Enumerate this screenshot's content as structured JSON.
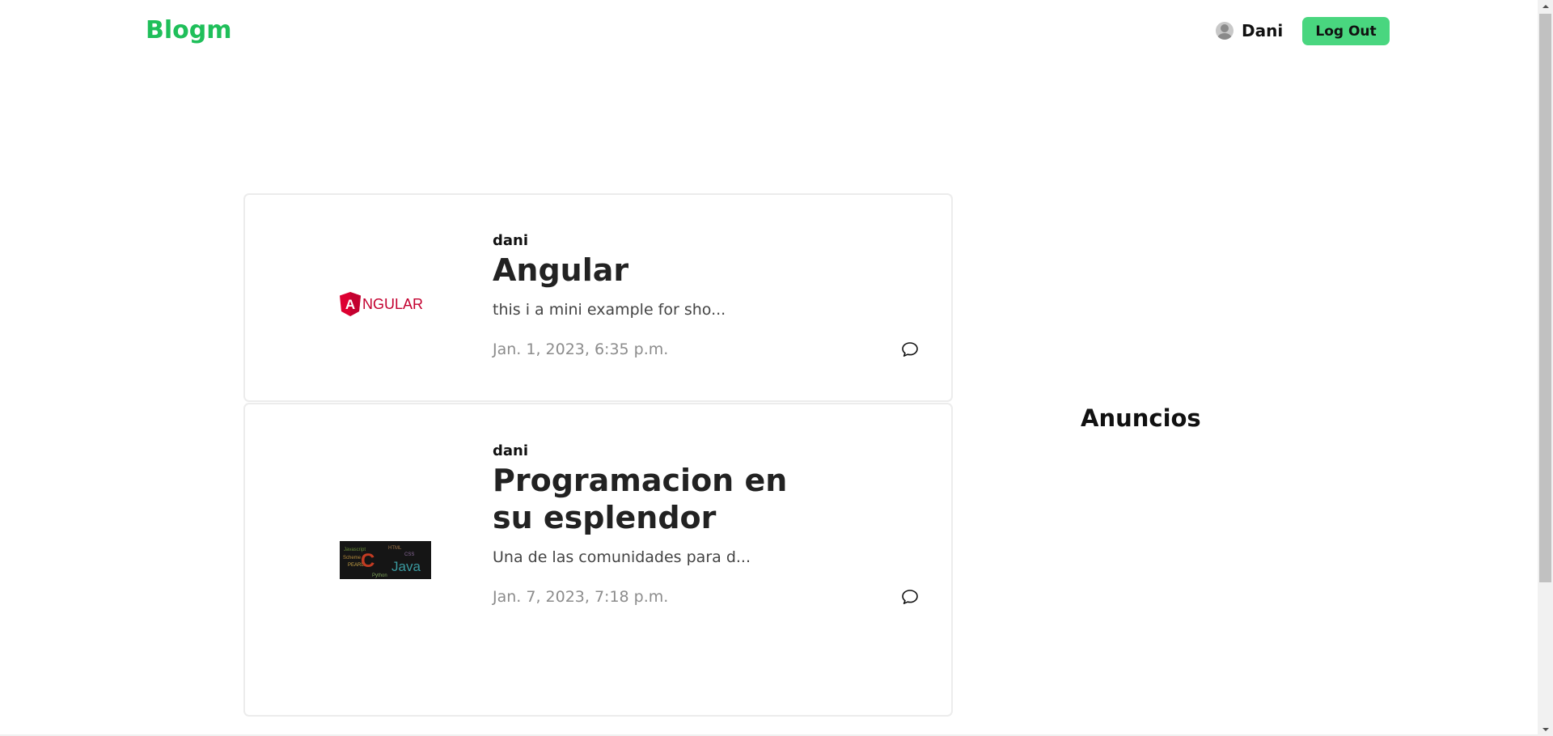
{
  "header": {
    "brand": "Blogm",
    "user_name": "Dani",
    "user_icon": "user-avatar-icon",
    "logout_label": "Log Out"
  },
  "posts": [
    {
      "author": "dani",
      "title": "Angular",
      "excerpt": "this i a mini example for sho...",
      "date": "Jan. 1, 2023, 6:35 p.m.",
      "thumbnail_text": "NGULAR",
      "thumbnail_logo_letter": "A",
      "icon": "comment-icon"
    },
    {
      "author": "dani",
      "title": "Programacion en su esplendor",
      "excerpt": "Una de las comunidades para d...",
      "date": "Jan. 7, 2023, 7:18 p.m.",
      "thumbnail_words": [
        "C",
        "Java",
        "PEARL",
        "Python",
        "Scheme",
        "Javascript",
        "HTML",
        "CSS"
      ],
      "icon": "comment-icon"
    }
  ],
  "sidebar": {
    "ads_title": "Anuncios"
  },
  "colors": {
    "brand": "#1fbf5a",
    "button_bg": "#49d67f",
    "angular_red": "#dd0031"
  }
}
